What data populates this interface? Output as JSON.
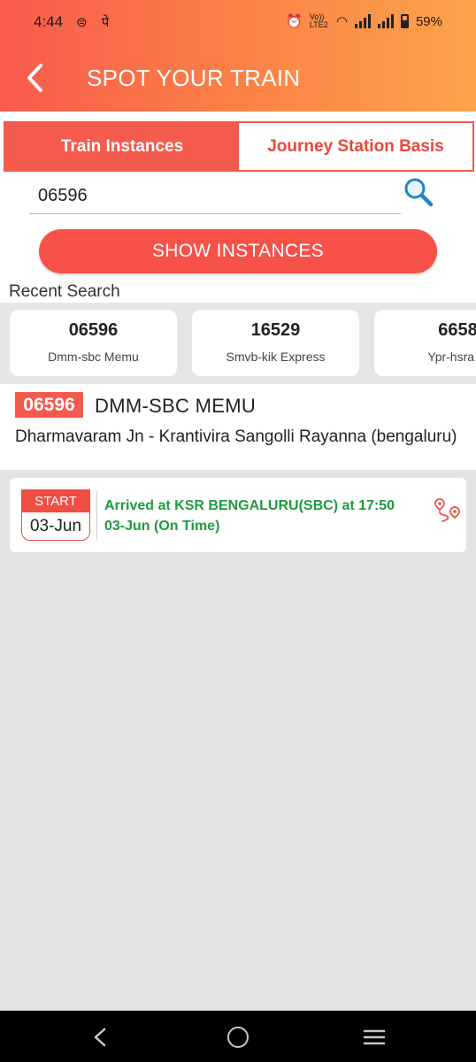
{
  "status_bar": {
    "time": "4:44",
    "left_icons": "⊜ पे",
    "network_label": "Vo)) LTE2",
    "battery": "59%"
  },
  "header": {
    "title": "SPOT YOUR TRAIN",
    "back_icon": "back-arrow-icon"
  },
  "tabs": [
    {
      "label": "Train Instances",
      "active": true
    },
    {
      "label": "Journey Station Basis",
      "active": false
    }
  ],
  "search": {
    "value": "06596",
    "icon": "search-icon"
  },
  "show_button": {
    "label": "SHOW INSTANCES"
  },
  "recent": {
    "label": "Recent Search",
    "items": [
      {
        "number": "06596",
        "name": "Dmm-sbc Memu"
      },
      {
        "number": "16529",
        "name": "Smvb-kik Express"
      },
      {
        "number": "6658",
        "name": "Ypr-hsra M"
      }
    ]
  },
  "train": {
    "number": "06596",
    "name": "DMM-SBC MEMU",
    "route": "Dharmavaram Jn - Krantivira Sangolli Rayanna (bengaluru)"
  },
  "instance": {
    "start_label": "START",
    "date": "03-Jun",
    "status_line1": "Arrived at KSR BENGALURU(SBC) at 17:50",
    "status_line2": "03-Jun (On Time)",
    "status_color": "#1f9a40",
    "route_icon": "route-map-icon"
  },
  "colors": {
    "accent": "#f55a4e",
    "header_gradient_start": "#f95a4c",
    "header_gradient_end": "#fda44a"
  }
}
